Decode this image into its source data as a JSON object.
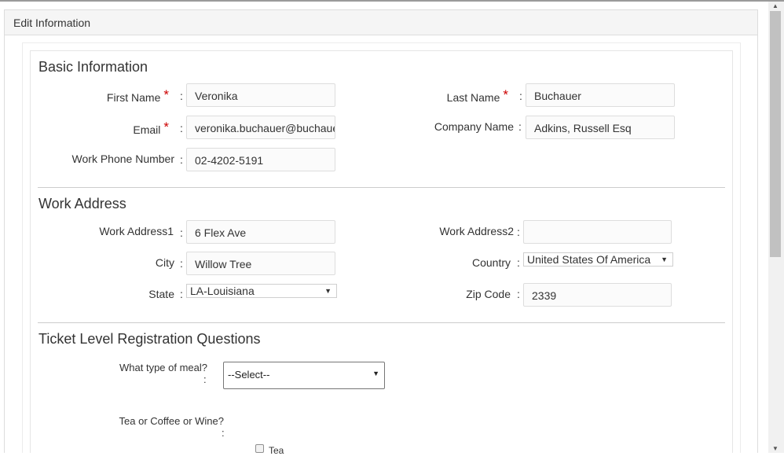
{
  "panel": {
    "title": "Edit Information"
  },
  "basic": {
    "title": "Basic Information",
    "first_name": {
      "label": "First Name",
      "value": "Veronika",
      "required": "*"
    },
    "last_name": {
      "label": "Last Name",
      "value": "Buchauer",
      "required": "*"
    },
    "email": {
      "label": "Email",
      "value": "veronika.buchauer@buchauer.com",
      "required": "*"
    },
    "company": {
      "label": "Company Name",
      "value": "Adkins, Russell Esq"
    },
    "phone": {
      "label": "Work Phone Number",
      "value": "02-4202-5191"
    }
  },
  "address": {
    "title": "Work Address",
    "address1": {
      "label": "Work Address1",
      "value": "6 Flex Ave"
    },
    "address2": {
      "label": "Work Address2",
      "value": ""
    },
    "city": {
      "label": "City",
      "value": "Willow Tree"
    },
    "country": {
      "label": "Country",
      "value": "United States Of America"
    },
    "state": {
      "label": "State",
      "value": "LA-Louisiana"
    },
    "zip": {
      "label": "Zip Code",
      "value": "2339"
    }
  },
  "questions": {
    "title": "Ticket Level Registration Questions",
    "meal": {
      "label": "What type of meal?",
      "value": "--Select--"
    },
    "drink": {
      "label": "Tea or Coffee or Wine?",
      "options": [
        "Tea"
      ]
    }
  },
  "colon": ":",
  "colors": {
    "required": "#cc0000",
    "border": "#dddddd",
    "header_bg": "#f5f5f5"
  },
  "icons": {
    "dropdown": "caret-down-icon",
    "scroll_up": "scroll-up-icon",
    "scroll_down": "scroll-down-icon"
  }
}
